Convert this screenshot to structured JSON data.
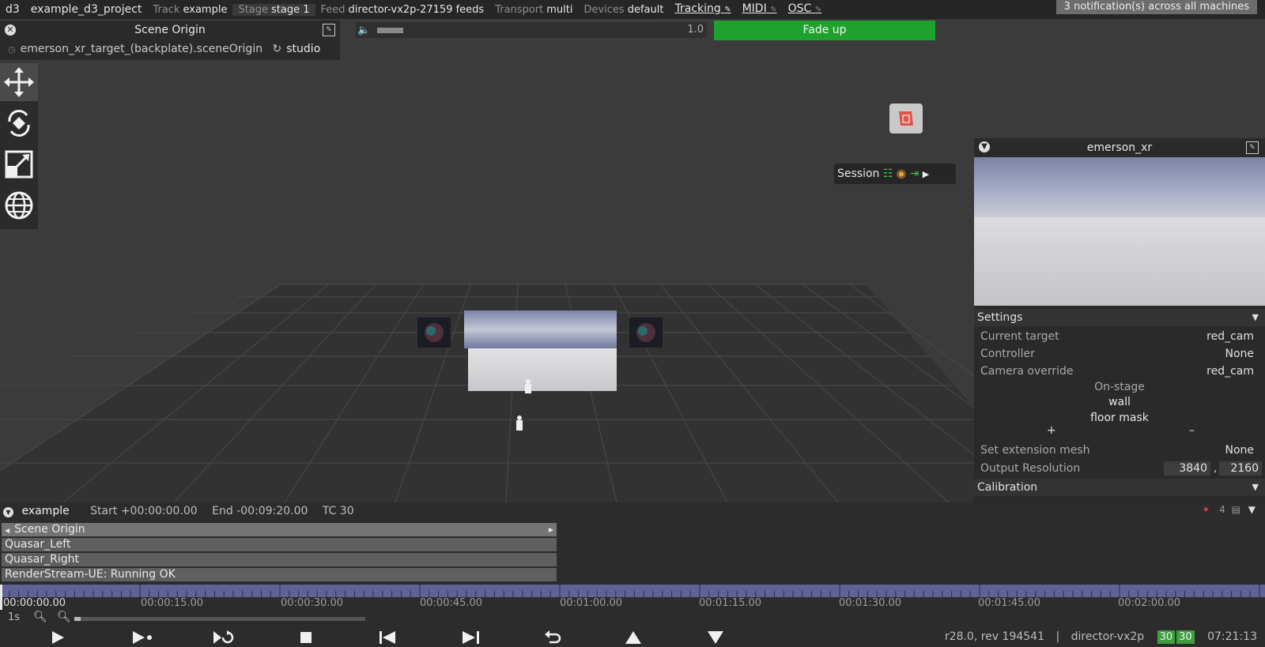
{
  "topbar": {
    "app": "d3",
    "project": "example_d3_project",
    "track_label": "Track",
    "track_value": "example",
    "stage_label": "Stage",
    "stage_value": "stage 1",
    "feed_label": "Feed",
    "feed_value": "director-vx2p-27159 feeds",
    "transport_label": "Transport",
    "transport_value": "multi",
    "devices_label": "Devices",
    "devices_value": "default",
    "tracking": "Tracking",
    "midi": "MIDI",
    "osc": "OSC",
    "notifications": "3 notification(s) across all machines"
  },
  "scene_origin": {
    "title": "Scene Origin",
    "path": "emerson_xr_target_(backplate).sceneOrigin",
    "mode": "studio"
  },
  "controls": {
    "rate": "1.0",
    "fade_button": "Fade up"
  },
  "session": {
    "label": "Session"
  },
  "right_panel": {
    "title": "emerson_xr",
    "settings_label": "Settings",
    "current_target_label": "Current target",
    "current_target_value": "red_cam",
    "controller_label": "Controller",
    "controller_value": "None",
    "camera_override_label": "Camera override",
    "camera_override_value": "red_cam",
    "onstage_label": "On-stage",
    "onstage_items": [
      "wall",
      "floor mask"
    ],
    "add": "+",
    "remove": "–",
    "extension_mesh_label": "Set extension mesh",
    "extension_mesh_value": "None",
    "output_res_label": "Output Resolution",
    "output_res_w": "3840",
    "output_res_sep": ",",
    "output_res_h": "2160",
    "calibration_label": "Calibration"
  },
  "timeline": {
    "track": "example",
    "start": "Start +00:00:00.00",
    "end": "End -00:09:20.00",
    "tc": "TC 30",
    "layer_count": "4",
    "layers": [
      "Scene Origin",
      "Quasar_Left",
      "Quasar_Right",
      "RenderStream-UE: Running OK"
    ],
    "ticks": [
      "00:00:00.00",
      "00:00:15.00",
      "00:00:30.00",
      "00:00:45.00",
      "00:01:00.00",
      "00:01:15.00",
      "00:01:30.00",
      "00:01:45.00",
      "00:02:00.00"
    ],
    "zoom_unit": "1s"
  },
  "status": {
    "version": "r28.0, rev 194541",
    "sep": "|",
    "machine": "director-vx2p",
    "fps1": "30",
    "fps2": "30",
    "time": "07:21:13"
  },
  "icons": {
    "move": "move-icon",
    "rotate": "rotate-icon",
    "scale": "scale-icon",
    "globe": "globe-icon",
    "accent_green": "#1fa12d",
    "ruler_color": "#5e6295",
    "cube_color": "#e0524a"
  }
}
